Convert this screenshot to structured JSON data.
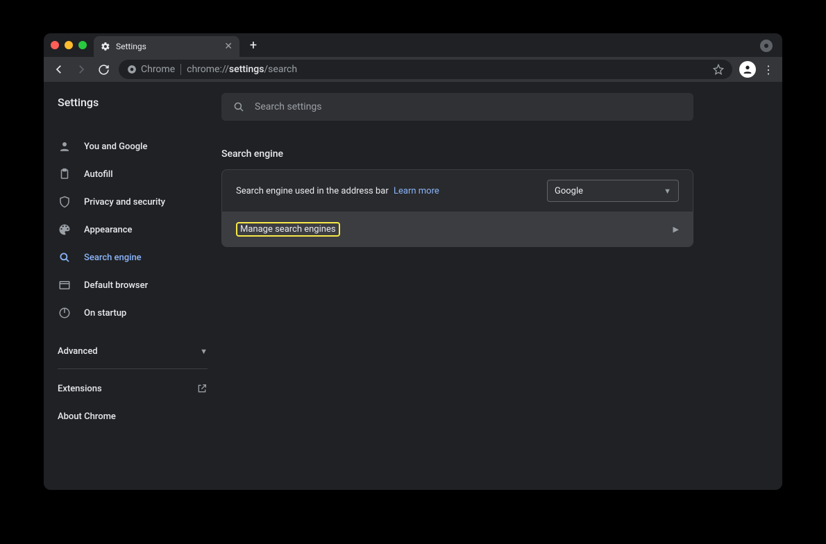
{
  "tab": {
    "title": "Settings"
  },
  "toolbar": {
    "chrome_label": "Chrome",
    "url_prefix": "chrome://",
    "url_bold": "settings",
    "url_suffix": "/search"
  },
  "sidebar": {
    "title": "Settings",
    "items": [
      {
        "label": "You and Google"
      },
      {
        "label": "Autofill"
      },
      {
        "label": "Privacy and security"
      },
      {
        "label": "Appearance"
      },
      {
        "label": "Search engine"
      },
      {
        "label": "Default browser"
      },
      {
        "label": "On startup"
      }
    ],
    "advanced": "Advanced",
    "extensions": "Extensions",
    "about": "About Chrome"
  },
  "search": {
    "placeholder": "Search settings"
  },
  "main": {
    "section_title": "Search engine",
    "row1_text": "Search engine used in the address bar",
    "learn_more": "Learn more",
    "selected_engine": "Google",
    "manage_label": "Manage search engines"
  }
}
